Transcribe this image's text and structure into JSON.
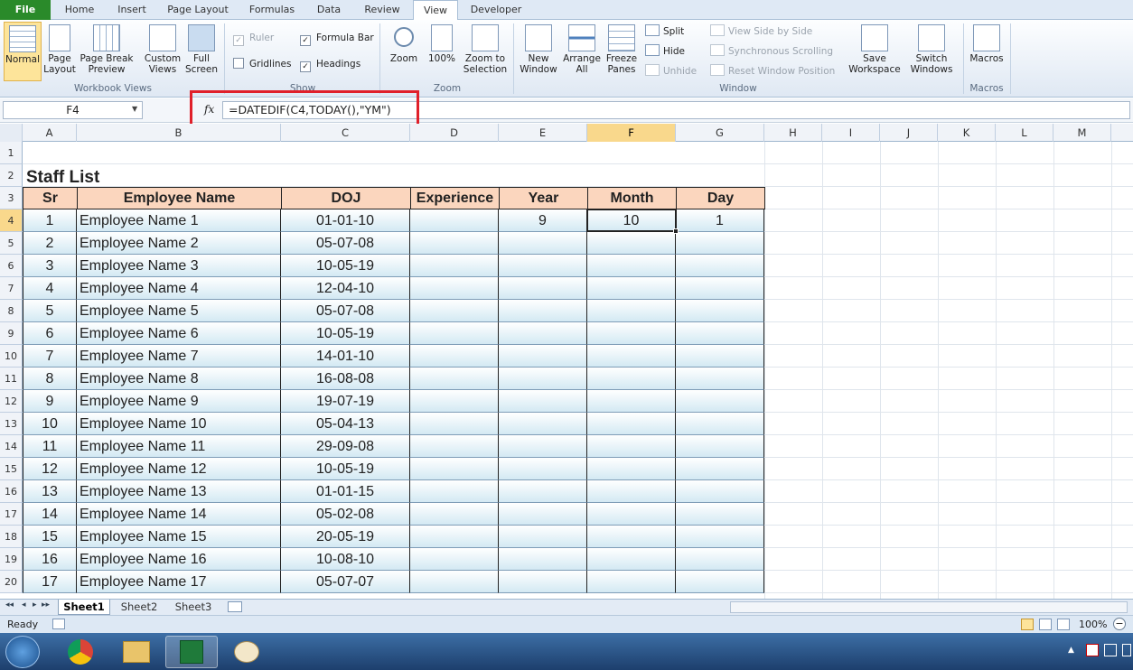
{
  "ribbon_tabs": [
    "File",
    "Home",
    "Insert",
    "Page Layout",
    "Formulas",
    "Data",
    "Review",
    "View",
    "Developer"
  ],
  "active_tab": "View",
  "ribbon": {
    "workbook_views": {
      "normal": "Normal",
      "page_layout": "Page Layout",
      "page_break": "Page Break Preview",
      "custom_views": "Custom Views",
      "full_screen": "Full Screen",
      "label": "Workbook Views"
    },
    "show": {
      "ruler": "Ruler",
      "formula_bar": "Formula Bar",
      "gridlines": "Gridlines",
      "headings": "Headings",
      "label": "Show"
    },
    "zoom": {
      "zoom": "Zoom",
      "zoom100": "100%",
      "zoom_selection": "Zoom to Selection",
      "label": "Zoom"
    },
    "window": {
      "new_window": "New Window",
      "arrange_all": "Arrange All",
      "freeze_panes": "Freeze Panes",
      "split": "Split",
      "hide": "Hide",
      "unhide": "Unhide",
      "side_by_side": "View Side by Side",
      "sync_scroll": "Synchronous Scrolling",
      "reset_position": "Reset Window Position",
      "save_workspace": "Save Workspace",
      "switch_windows": "Switch Windows",
      "label": "Window"
    },
    "macros": {
      "macros": "Macros",
      "label": "Macros"
    }
  },
  "formula_bar": {
    "name_box": "F4",
    "fx": "fx",
    "formula": "=DATEDIF(C4,TODAY(),\"YM\")"
  },
  "columns": [
    "A",
    "B",
    "C",
    "D",
    "E",
    "F",
    "G",
    "H",
    "I",
    "J",
    "K",
    "L",
    "M"
  ],
  "selected_column": "F",
  "sheet": {
    "title": "Staff List",
    "headers": [
      "Sr",
      "Employee Name",
      "DOJ",
      "Experience",
      "Year",
      "Month",
      "Day"
    ],
    "rows": [
      [
        "1",
        "Employee Name 1",
        "01-01-10",
        "",
        "9",
        "10",
        "1"
      ],
      [
        "2",
        "Employee Name 2",
        "05-07-08",
        "",
        "",
        "",
        ""
      ],
      [
        "3",
        "Employee Name 3",
        "10-05-19",
        "",
        "",
        "",
        ""
      ],
      [
        "4",
        "Employee Name 4",
        "12-04-10",
        "",
        "",
        "",
        ""
      ],
      [
        "5",
        "Employee Name 5",
        "05-07-08",
        "",
        "",
        "",
        ""
      ],
      [
        "6",
        "Employee Name 6",
        "10-05-19",
        "",
        "",
        "",
        ""
      ],
      [
        "7",
        "Employee Name 7",
        "14-01-10",
        "",
        "",
        "",
        ""
      ],
      [
        "8",
        "Employee Name 8",
        "16-08-08",
        "",
        "",
        "",
        ""
      ],
      [
        "9",
        "Employee Name 9",
        "19-07-19",
        "",
        "",
        "",
        ""
      ],
      [
        "10",
        "Employee Name 10",
        "05-04-13",
        "",
        "",
        "",
        ""
      ],
      [
        "11",
        "Employee Name 11",
        "29-09-08",
        "",
        "",
        "",
        ""
      ],
      [
        "12",
        "Employee Name 12",
        "10-05-19",
        "",
        "",
        "",
        ""
      ],
      [
        "13",
        "Employee Name 13",
        "01-01-15",
        "",
        "",
        "",
        ""
      ],
      [
        "14",
        "Employee Name 14",
        "05-02-08",
        "",
        "",
        "",
        ""
      ],
      [
        "15",
        "Employee Name 15",
        "20-05-19",
        "",
        "",
        "",
        ""
      ],
      [
        "16",
        "Employee Name 16",
        "10-08-10",
        "",
        "",
        "",
        ""
      ],
      [
        "17",
        "Employee Name 17",
        "05-07-07",
        "",
        "",
        "",
        ""
      ]
    ]
  },
  "row_numbers": [
    "1",
    "2",
    "3",
    "4",
    "5",
    "6",
    "7",
    "8",
    "9",
    "10",
    "11",
    "12",
    "13",
    "14",
    "15",
    "16",
    "17",
    "18",
    "19",
    "20"
  ],
  "selected_row": "4",
  "sheet_tabs": [
    "Sheet1",
    "Sheet2",
    "Sheet3"
  ],
  "active_sheet": "Sheet1",
  "status": {
    "ready": "Ready",
    "zoom": "100%"
  },
  "colors": {
    "accent_file": "#2a8a2a",
    "header_fill": "#fbd6be",
    "selection": "#f9d88c",
    "highlight_box": "#e0202a"
  }
}
